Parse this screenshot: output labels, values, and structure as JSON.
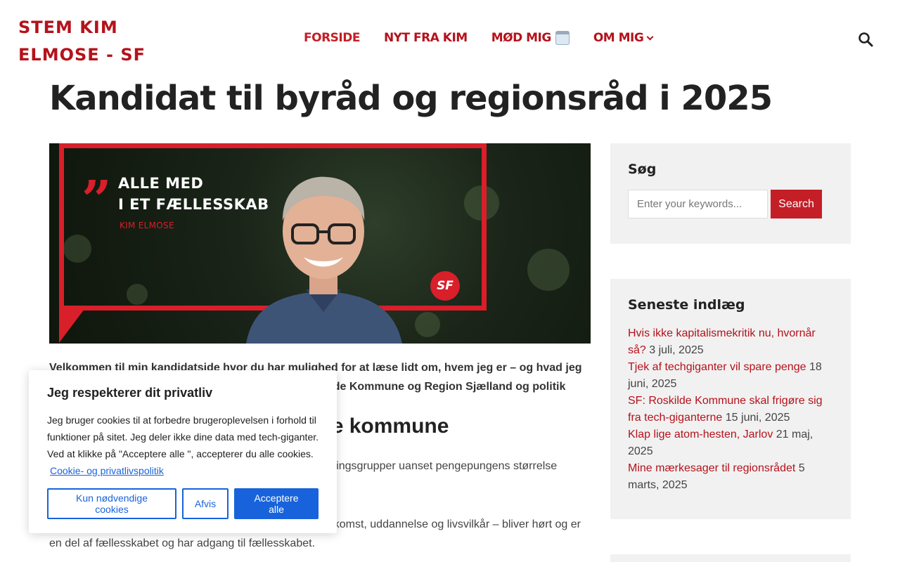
{
  "header": {
    "site_title": "STEM KIM ELMOSE - SF",
    "nav": [
      {
        "label": "FORSIDE"
      },
      {
        "label": "NYT FRA KIM"
      },
      {
        "label": "MØD MIG"
      },
      {
        "label": "OM MIG"
      }
    ]
  },
  "page": {
    "title": "Kandidat til byråd og regionsråd i 2025",
    "hero": {
      "line1": "ALLE MED",
      "line2": "I ET FÆLLESSKAB",
      "name": "KIM ELMOSE",
      "logo": "SF"
    },
    "intro": "Velkommen til min kandidatside hvor du har mulighed for at læse lidt om, hvem jeg er – og hvad jeg har af mærkesager – og hvad jeg kæmper for i Roskilde Kommune og Region Sjælland og politik",
    "subheading": "En retfærdig og inkluderende kommune",
    "para1": "Jeg ønsker et fællesskab, hvor der er plads til alle befolkningsgrupper uanset pengepungens størrelse",
    "para2": "Jeg vil arbejde for, at alle borgere – uanset baggrund, indkomst, uddannelse og livsvilkår – bliver hørt og er en del af fællesskabet og har adgang til fællesskabet."
  },
  "sidebar": {
    "search": {
      "title": "Søg",
      "placeholder": "Enter your keywords...",
      "button": "Search"
    },
    "recent": {
      "title": "Seneste indlæg",
      "posts": [
        {
          "title": "Hvis ikke kapitalismekritik nu, hvornår så?",
          "date": "3 juli, 2025"
        },
        {
          "title": "Tjek af techgiganter vil spare penge",
          "date": "18 juni, 2025"
        },
        {
          "title": "SF: Roskilde Kommune skal frigøre sig fra tech-giganterne",
          "date": "15 juni, 2025"
        },
        {
          "title": "Klap lige atom-hesten, Jarlov",
          "date": "21 maj, 2025"
        },
        {
          "title": "Mine mærkesager til regionsrådet",
          "date": "5 marts, 2025"
        }
      ]
    }
  },
  "cookie": {
    "title": "Jeg respekterer dit privatliv",
    "text": "Jeg bruger cookies til at forbedre brugeroplevelsen i forhold til funktioner på sitet. Jeg deler ikke dine data med tech-giganter. Ved at klikke på \"Acceptere alle \", accepterer du alle cookies.",
    "link": "Cookie- og privatlivspolitik",
    "buttons": {
      "necessary": "Kun nødvendige cookies",
      "reject": "Afvis",
      "accept": "Acceptere alle"
    }
  },
  "colors": {
    "brand_red": "#b5121b",
    "cookie_blue": "#1863dc",
    "sidebar_bg": "#f1f1f1"
  },
  "icons": {
    "search": "search-icon",
    "calendar": "calendar-icon",
    "dropdown": "chevron-down-icon"
  }
}
